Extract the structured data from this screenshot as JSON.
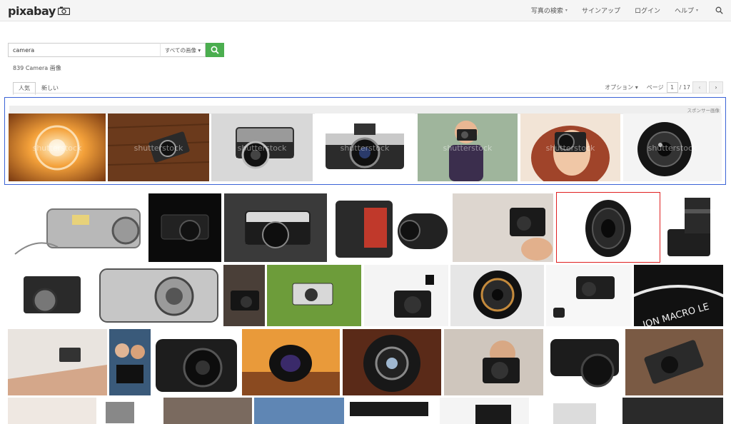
{
  "header": {
    "logo_text": "pixabay",
    "nav": [
      {
        "label": "写真の検索",
        "caret": "▾"
      },
      {
        "label": "サインアップ",
        "caret": ""
      },
      {
        "label": "ログイン",
        "caret": ""
      },
      {
        "label": "ヘルプ",
        "caret": "▾"
      }
    ],
    "search_icon": "search-icon"
  },
  "search": {
    "value": "camera",
    "type_label": "すべての画像 ▾"
  },
  "results": {
    "count_text": "839 Camera 画像"
  },
  "tabs": [
    {
      "label": "人気",
      "active": true
    },
    {
      "label": "新しい",
      "active": false
    }
  ],
  "toolbar": {
    "options_label": "オプション ▾",
    "page_label": "ページ",
    "page_value": "1",
    "page_total": "/ 17",
    "prev_icon": "‹",
    "next_icon": "›"
  },
  "sponsored": {
    "label": "スポンサー画像",
    "watermark": "shutterstock",
    "items": [
      {
        "name": "lens-aperture-orange",
        "watermark": true
      },
      {
        "name": "retro-camera-wood",
        "watermark": true
      },
      {
        "name": "rangefinder-bw",
        "watermark": true
      },
      {
        "name": "slr-camera-white",
        "watermark": true
      },
      {
        "name": "boy-with-camera",
        "watermark": true
      },
      {
        "name": "woman-with-camera",
        "watermark": true
      },
      {
        "name": "lens-black",
        "watermark": true
      }
    ]
  },
  "colors": {
    "accent_green": "#4bae4f",
    "sponsor_border": "#3b63d6",
    "selected_border": "#e02020"
  }
}
